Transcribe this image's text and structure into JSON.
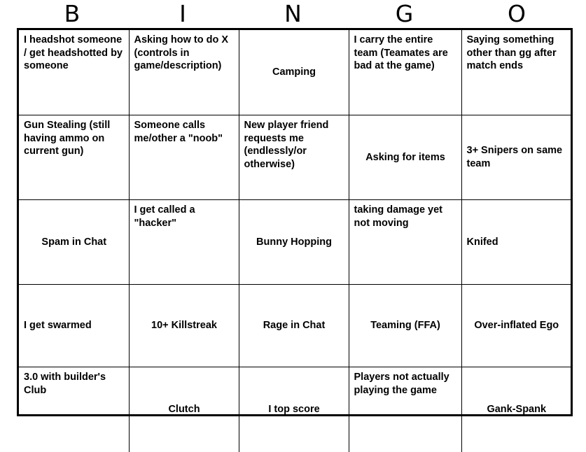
{
  "card": {
    "type": "bingo-card",
    "columns": 5,
    "rows": 5,
    "theme": {
      "background": "#ffffff",
      "ink": "#000000",
      "outer_border": "#000000",
      "grid_line": "#000000"
    }
  },
  "header": {
    "letters": [
      {
        "label": "B"
      },
      {
        "label": "I"
      },
      {
        "label": "N"
      },
      {
        "label": "G"
      },
      {
        "label": "O"
      }
    ]
  },
  "grid": {
    "rows": [
      {
        "cells": [
          {
            "text": "I headshot someone / get headshotted by someone",
            "valign": "top",
            "halign": "left"
          },
          {
            "text": "Asking how to do X (controls in game/description)",
            "valign": "top",
            "halign": "left"
          },
          {
            "text": "Camping",
            "valign": "middle",
            "halign": "center"
          },
          {
            "text": "I carry the entire team (Teamates are bad at the game)",
            "valign": "top",
            "halign": "left"
          },
          {
            "text": "Saying something other than gg after match ends",
            "valign": "top",
            "halign": "left"
          }
        ]
      },
      {
        "cells": [
          {
            "text": "Gun Stealing (still having ammo on current gun)",
            "valign": "top",
            "halign": "left"
          },
          {
            "text": "Someone calls me/other a \"noob\"",
            "valign": "top",
            "halign": "left"
          },
          {
            "text": "New player friend requests me (endlessly/or otherwise)",
            "valign": "top",
            "halign": "left"
          },
          {
            "text": "Asking for items",
            "valign": "middle",
            "halign": "center"
          },
          {
            "text": "3+ Snipers on same team",
            "valign": "middle",
            "halign": "left"
          }
        ]
      },
      {
        "cells": [
          {
            "text": "Spam in Chat",
            "valign": "middle",
            "halign": "center"
          },
          {
            "text": "I get called a \"hacker\"",
            "valign": "top",
            "halign": "left"
          },
          {
            "text": "Bunny Hopping",
            "valign": "middle",
            "halign": "center"
          },
          {
            "text": "taking damage yet not moving",
            "valign": "top",
            "halign": "left"
          },
          {
            "text": "Knifed",
            "valign": "middle",
            "halign": "left"
          }
        ]
      },
      {
        "cells": [
          {
            "text": "I get swarmed",
            "valign": "middle",
            "halign": "left"
          },
          {
            "text": "10+ Killstreak",
            "valign": "middle",
            "halign": "center"
          },
          {
            "text": "Rage in Chat",
            "valign": "middle",
            "halign": "center"
          },
          {
            "text": "Teaming (FFA)",
            "valign": "middle",
            "halign": "center"
          },
          {
            "text": "Over-inflated Ego",
            "valign": "middle",
            "halign": "center"
          }
        ]
      },
      {
        "cells": [
          {
            "text": "3.0 with builder's Club",
            "valign": "top",
            "halign": "left"
          },
          {
            "text": "Clutch",
            "valign": "middle",
            "halign": "center"
          },
          {
            "text": "I top score",
            "valign": "middle",
            "halign": "center"
          },
          {
            "text": "Players not actually playing the game",
            "valign": "top",
            "halign": "left"
          },
          {
            "text": "Gank-Spank",
            "valign": "middle",
            "halign": "center"
          }
        ]
      }
    ]
  }
}
